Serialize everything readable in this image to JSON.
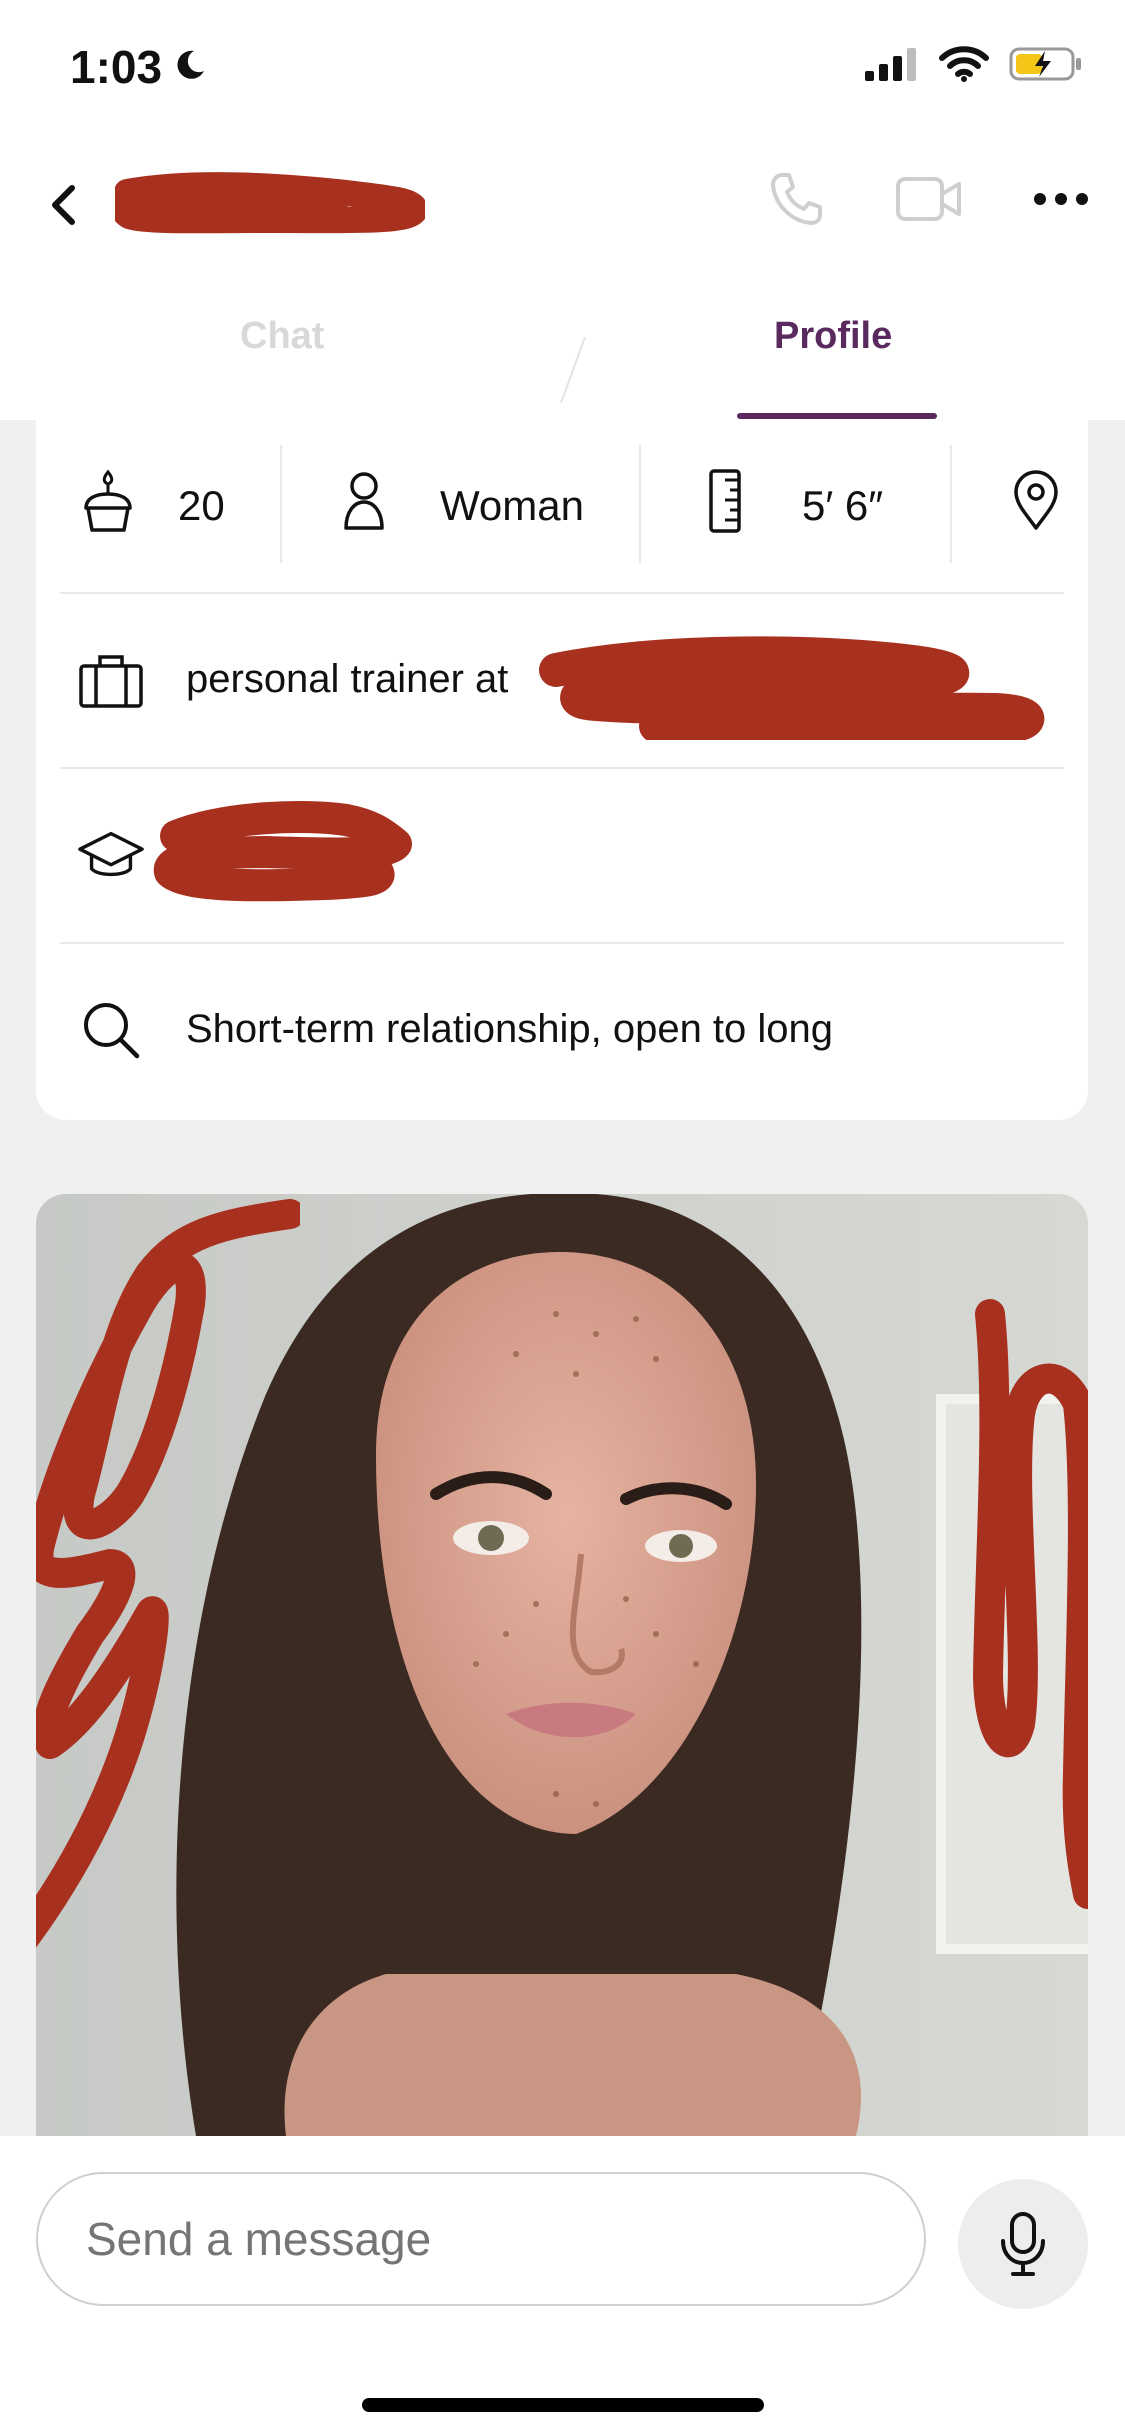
{
  "status_bar": {
    "time": "1:03",
    "icons": [
      "moon-icon",
      "signal-icon",
      "wifi-icon",
      "battery-charging-icon"
    ]
  },
  "nav": {
    "back_icon": "chevron-left-icon",
    "actions": [
      "phone-icon",
      "video-icon",
      "more-icon"
    ]
  },
  "tabs": [
    {
      "label": "Chat",
      "active": false
    },
    {
      "label": "Profile",
      "active": true
    }
  ],
  "profile": {
    "stats": [
      {
        "icon": "cake-icon",
        "value": "20"
      },
      {
        "icon": "person-icon",
        "value": "Woman"
      },
      {
        "icon": "ruler-icon",
        "value": "5′ 6″"
      },
      {
        "icon": "location-pin-icon",
        "value": ""
      }
    ],
    "job": {
      "icon": "briefcase-icon",
      "text": "personal trainer at"
    },
    "education": {
      "icon": "graduation-cap-icon"
    },
    "looking_for": {
      "icon": "search-icon",
      "text": "Short-term relationship, open to long"
    }
  },
  "composer": {
    "placeholder": "Send a message",
    "mic_icon": "microphone-icon"
  },
  "colors": {
    "accent": "#5a2a5e",
    "redaction": "#a8301f",
    "page_background": "#f0f0f0"
  }
}
